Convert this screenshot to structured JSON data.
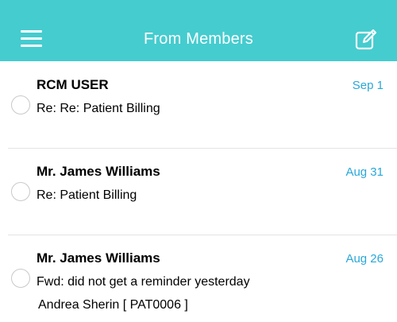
{
  "header": {
    "title": "From Members",
    "background": "#45cccf"
  },
  "messages": [
    {
      "sender": "RCM USER",
      "date": "Sep 1",
      "subject": "Re: Re: Patient Billing",
      "preview": ""
    },
    {
      "sender": "Mr. James Williams",
      "date": "Aug 31",
      "subject": "Re: Patient Billing",
      "preview": ""
    },
    {
      "sender": "Mr. James Williams",
      "date": "Aug 26",
      "subject": "Fwd: did not get a reminder yesterday",
      "preview": "Andrea Sherin [ PAT0006 ]"
    }
  ],
  "icons": {
    "menu": "hamburger-menu-icon",
    "compose": "compose-icon"
  },
  "colors": {
    "accent": "#45cccf",
    "date": "#2aa7d8"
  }
}
